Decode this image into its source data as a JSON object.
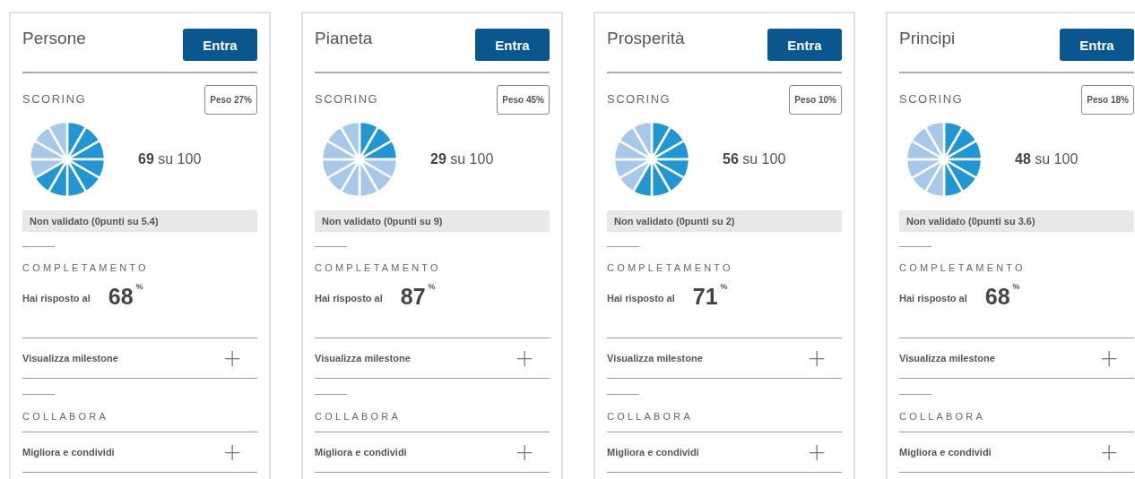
{
  "cards": [
    {
      "title": "Persone",
      "button": "Entra",
      "scoring_label": "SCORING",
      "weight": "Peso 27%",
      "score": "69",
      "score_suffix": "su 100",
      "level": 0.667,
      "validation": "Non validato (0punti su 5.4)",
      "completion_label": "COMPLETAMENTO",
      "answered_label": "Hai risposto al",
      "percent": "68",
      "percent_sign": "%",
      "milestone": "Visualizza milestone",
      "milestone_icon": "+",
      "collab_label": "COLLABORA",
      "improve": "Migliora e condividi",
      "improve_icon": "+"
    },
    {
      "title": "Pianeta",
      "button": "Entra",
      "scoring_label": "SCORING",
      "weight": "Peso 45%",
      "score": "29",
      "score_suffix": "su 100",
      "level": 0.25,
      "validation": "Non validato (0punti su 9)",
      "completion_label": "COMPLETAMENTO",
      "answered_label": "Hai risposto al",
      "percent": "87",
      "percent_sign": "%",
      "milestone": "Visualizza milestone",
      "milestone_icon": "+",
      "collab_label": "COLLABORA",
      "improve": "Migliora e condividi",
      "improve_icon": "+"
    },
    {
      "title": "Prosperità",
      "button": "Entra",
      "scoring_label": "SCORING",
      "weight": "Peso 10%",
      "score": "56",
      "score_suffix": "su 100",
      "level": 0.583,
      "validation": "Non validato (0punti su 2)",
      "completion_label": "COMPLETAMENTO",
      "answered_label": "Hai risposto al",
      "percent": "71",
      "percent_sign": "%",
      "milestone": "Visualizza milestone",
      "milestone_icon": "+",
      "collab_label": "COLLABORA",
      "improve": "Migliora e condividi",
      "improve_icon": "+"
    },
    {
      "title": "Principi",
      "button": "Entra",
      "scoring_label": "SCORING",
      "weight": "Peso 18%",
      "score": "48",
      "score_suffix": "su 100",
      "level": 0.5,
      "validation": "Non validato (0punti su 3.6)",
      "completion_label": "COMPLETAMENTO",
      "answered_label": "Hai risposto al",
      "percent": "68",
      "percent_sign": "%",
      "milestone": "Visualizza milestone",
      "milestone_icon": "+",
      "collab_label": "COLLABORA",
      "improve": "Migliora e condividi",
      "improve_icon": "+"
    }
  ]
}
